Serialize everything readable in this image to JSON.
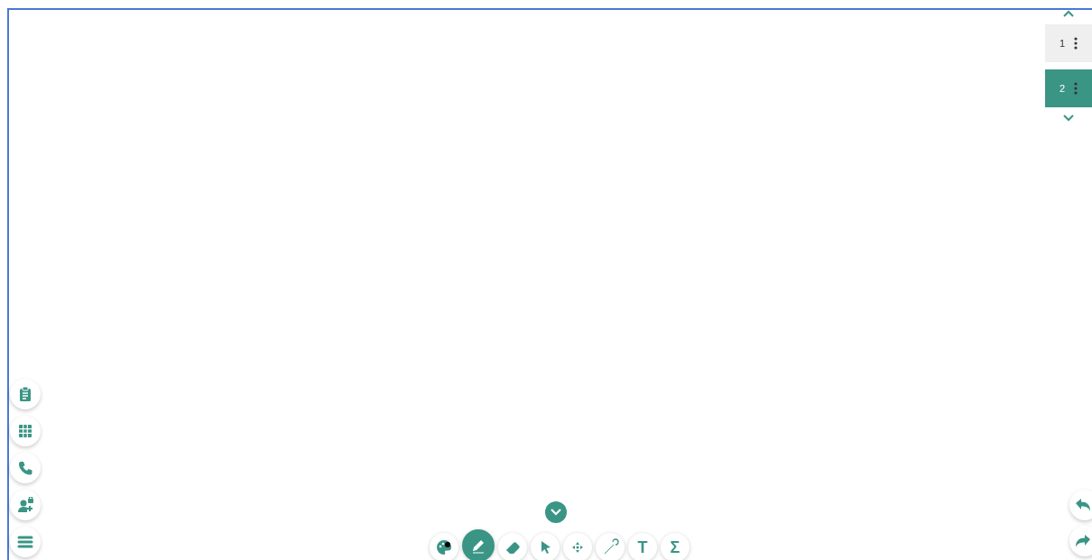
{
  "pages": [
    {
      "number": "1",
      "selected": false
    },
    {
      "number": "2",
      "selected": true
    }
  ],
  "side_tools": [
    {
      "kind": "clipboard"
    },
    {
      "kind": "grid"
    },
    {
      "kind": "phone"
    },
    {
      "kind": "user-lock"
    },
    {
      "kind": "menu"
    }
  ],
  "tools": [
    {
      "kind": "palette",
      "selected": false
    },
    {
      "kind": "pen",
      "selected": true
    },
    {
      "kind": "eraser",
      "selected": false
    },
    {
      "kind": "pointer",
      "selected": false
    },
    {
      "kind": "move",
      "selected": false
    },
    {
      "kind": "laser",
      "selected": false
    },
    {
      "kind": "glyph",
      "label": "T",
      "selected": false
    },
    {
      "kind": "glyph",
      "label": "Σ",
      "selected": false
    }
  ],
  "history": [
    {
      "kind": "undo"
    },
    {
      "kind": "redo"
    }
  ]
}
